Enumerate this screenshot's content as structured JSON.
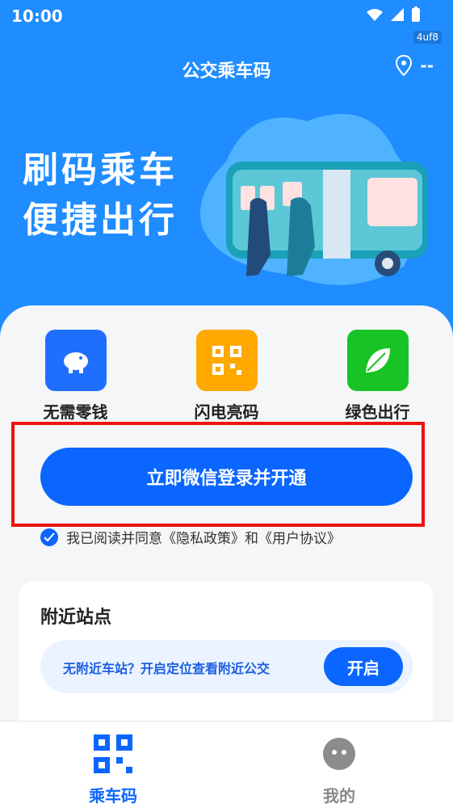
{
  "status_bar": {
    "time": "10:00",
    "badge": "4uf8"
  },
  "header": {
    "title": "公交乘车码",
    "location_value": "--"
  },
  "hero": {
    "line1": "刷码乘车",
    "line2": "便捷出行"
  },
  "features": [
    {
      "label": "无需零钱",
      "icon": "piggy-bank-icon",
      "color": "#1f6fff"
    },
    {
      "label": "闪电亮码",
      "icon": "qr-code-icon",
      "color": "#ffa800"
    },
    {
      "label": "绿色出行",
      "icon": "leaf-icon",
      "color": "#18c425"
    }
  ],
  "login": {
    "button_label": "立即微信登录并开通"
  },
  "agreement": {
    "text": "我已阅读并同意《隐私政策》和《用户协议》"
  },
  "nearby": {
    "title": "附近站点",
    "tip": "无附近车站？开启定位查看附近公交",
    "button_label": "开启"
  },
  "bottom_nav": [
    {
      "label": "乘车码",
      "icon": "qr-code-icon",
      "active": true
    },
    {
      "label": "我的",
      "icon": "profile-icon",
      "active": false
    }
  ],
  "colors": {
    "primary": "#1f8cff",
    "button": "#0a66ff",
    "highlight": "#e11"
  }
}
